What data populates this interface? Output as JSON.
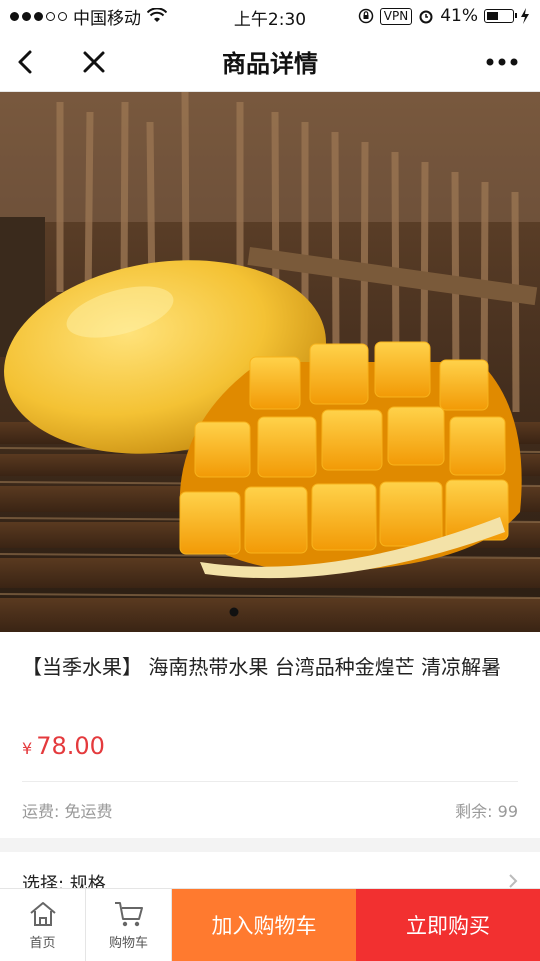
{
  "status_bar": {
    "carrier": "中国移动",
    "time": "上午2:30",
    "vpn": "VPN",
    "battery_percent": "41%"
  },
  "nav": {
    "title": "商品详情",
    "icons": [
      "back-icon",
      "close-icon",
      "more-icon"
    ]
  },
  "hero": {
    "carousel_active_index": 0,
    "carousel_count": 1
  },
  "product": {
    "title": "【当季水果】 海南热带水果 台湾品种金煌芒 清凉解暑",
    "currency": "¥",
    "price": "78.00",
    "shipping": "运费: 免运费",
    "stock": "剩余: 99",
    "spec_label": "选择: 规格"
  },
  "bottom_bar": {
    "home_label": "首页",
    "cart_label": "购物车",
    "add_to_cart": "加入购物车",
    "buy_now": "立即购买"
  },
  "colors": {
    "price": "#e43a3d",
    "add_to_cart_bg": "#ff7a2f",
    "buy_now_bg": "#f23030"
  }
}
